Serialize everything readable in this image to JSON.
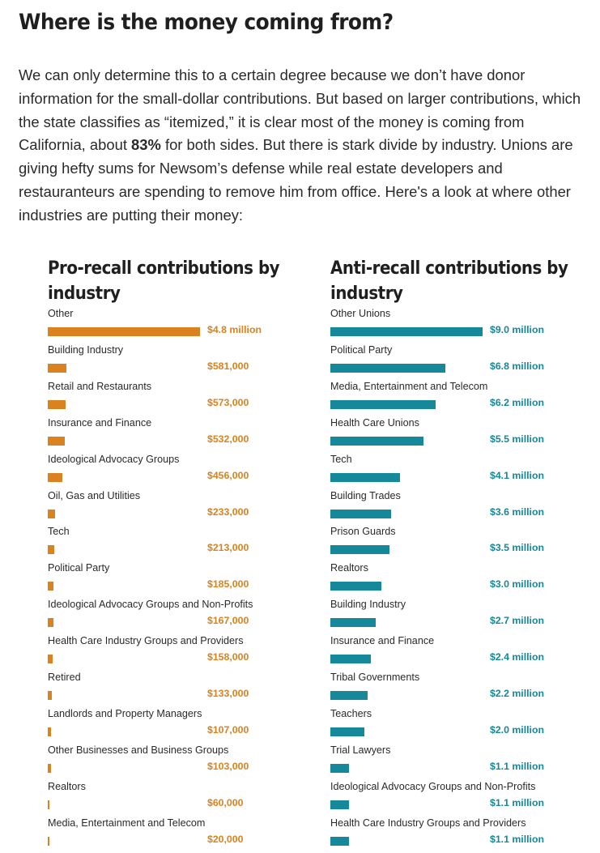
{
  "heading": "Where is the money coming from?",
  "intro": {
    "text_before": "We can only determine this to a certain degree because we don’t have donor information for the small-dollar contributions. But based on larger contributions, which the state classifies as “itemized,” it is clear most of the money is coming from California, about ",
    "bold": "83%",
    "text_after": " for both sides. But there is stark divide by industry. Unions are giving hefty sums for Newsom’s defense while real estate developers and restauranteurs are spending to remove him from office. Here's a look at where other industries are putting their money:"
  },
  "colors": {
    "pro": "#d9821f",
    "anti": "#15889a"
  },
  "chart_data": [
    {
      "type": "bar",
      "orientation": "horizontal",
      "title": "Pro-recall contributions by industry",
      "color": "#d9821f",
      "categories": [
        "Other",
        "Building Industry",
        "Retail and Restaurants",
        "Insurance and Finance",
        "Ideological Advocacy Groups",
        "Oil, Gas and Utilities",
        "Tech",
        "Political Party",
        "Ideological Advocacy Groups and Non-Profits",
        "Health Care Industry Groups and Providers",
        "Retired",
        "Landlords and Property Managers",
        "Other Businesses and Business Groups",
        "Realtors",
        "Media, Entertainment and Telecom"
      ],
      "values": [
        4800000,
        581000,
        573000,
        532000,
        456000,
        233000,
        213000,
        185000,
        167000,
        158000,
        133000,
        107000,
        103000,
        60000,
        20000
      ],
      "value_labels": [
        "$4.8 million",
        "$581,000",
        "$573,000",
        "$532,000",
        "$456,000",
        "$233,000",
        "$213,000",
        "$185,000",
        "$167,000",
        "$158,000",
        "$133,000",
        "$107,000",
        "$103,000",
        "$60,000",
        "$20,000"
      ]
    },
    {
      "type": "bar",
      "orientation": "horizontal",
      "title": "Anti-recall contributions by industry",
      "color": "#15889a",
      "categories": [
        "Other Unions",
        "Political Party",
        "Media, Entertainment and Telecom",
        "Health Care Unions",
        "Tech",
        "Building Trades",
        "Prison Guards",
        "Realtors",
        "Building Industry",
        "Insurance and Finance",
        "Tribal Governments",
        "Teachers",
        "Trial Lawyers",
        "Ideological Advocacy Groups and Non-Profits",
        "Health Care Industry Groups and Providers"
      ],
      "values": [
        9000000,
        6800000,
        6200000,
        5500000,
        4100000,
        3600000,
        3500000,
        3000000,
        2700000,
        2400000,
        2200000,
        2000000,
        1100000,
        1100000,
        1100000
      ],
      "value_labels": [
        "$9.0 million",
        "$6.8 million",
        "$6.2 million",
        "$5.5 million",
        "$4.1 million",
        "$3.6 million",
        "$3.5 million",
        "$3.0 million",
        "$2.7 million",
        "$2.4 million",
        "$2.2 million",
        "$2.0 million",
        "$1.1 million",
        "$1.1 million",
        "$1.1 million"
      ]
    }
  ]
}
